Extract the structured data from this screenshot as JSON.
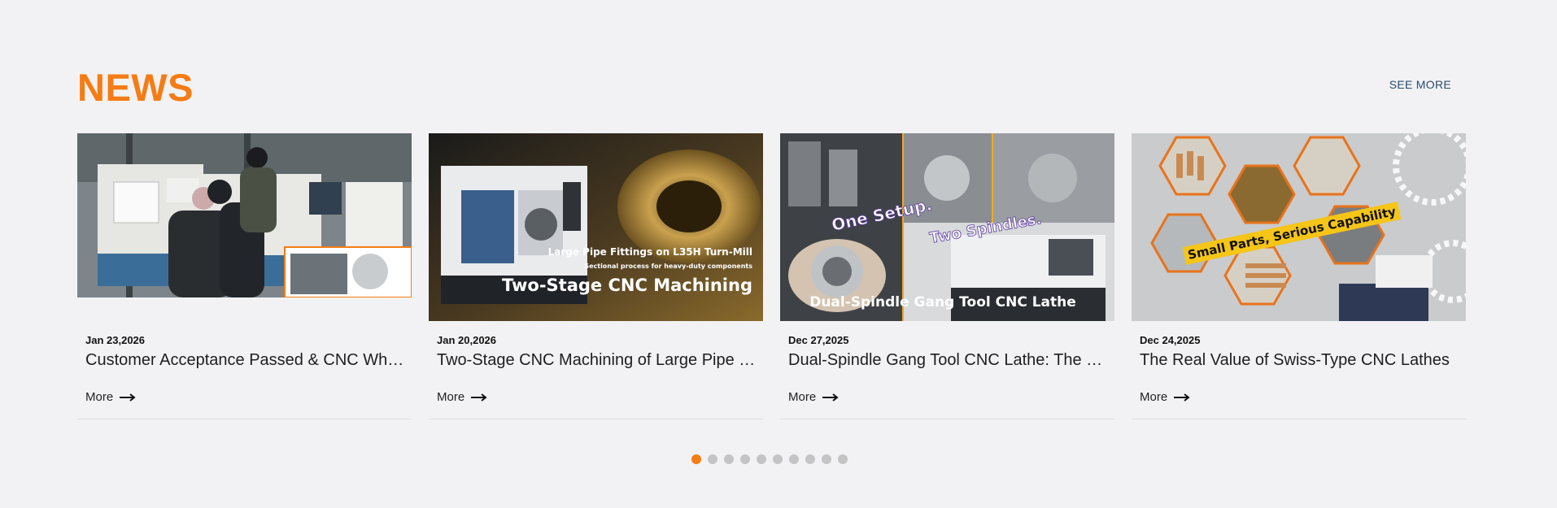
{
  "section": {
    "title": "NEWS",
    "see_more": "SEE MORE"
  },
  "cards": [
    {
      "date": "Jan 23,2026",
      "headline": "Customer Acceptance Passed & CNC Wh…",
      "more": "More",
      "image": {
        "overlay_lines": []
      }
    },
    {
      "date": "Jan 20,2026",
      "headline": "Two-Stage CNC Machining of Large Pipe …",
      "more": "More",
      "image": {
        "overlay_small_1": "Large Pipe Fittings on L35H Turn-Mill",
        "overlay_small_2": "Sectional process for heavy-duty components",
        "overlay_big": "Two-Stage CNC Machining"
      }
    },
    {
      "date": "Dec 27,2025",
      "headline": "Dual-Spindle Gang Tool CNC Lathe: The …",
      "more": "More",
      "image": {
        "overlay_1": "One Setup.",
        "overlay_2": "Two Spindles.",
        "overlay_big": "Dual-Spindle Gang Tool CNC Lathe"
      }
    },
    {
      "date": "Dec 24,2025",
      "headline": "The Real Value of Swiss-Type CNC Lathes",
      "more": "More",
      "image": {
        "overlay_banner": "Small Parts, Serious Capability"
      }
    }
  ],
  "pagination": {
    "total": 10,
    "active_index": 0
  },
  "colors": {
    "accent": "#f57c14",
    "link": "#2b4a6e",
    "dot_inactive": "#c4c4c4",
    "background": "#f2f2f4"
  }
}
